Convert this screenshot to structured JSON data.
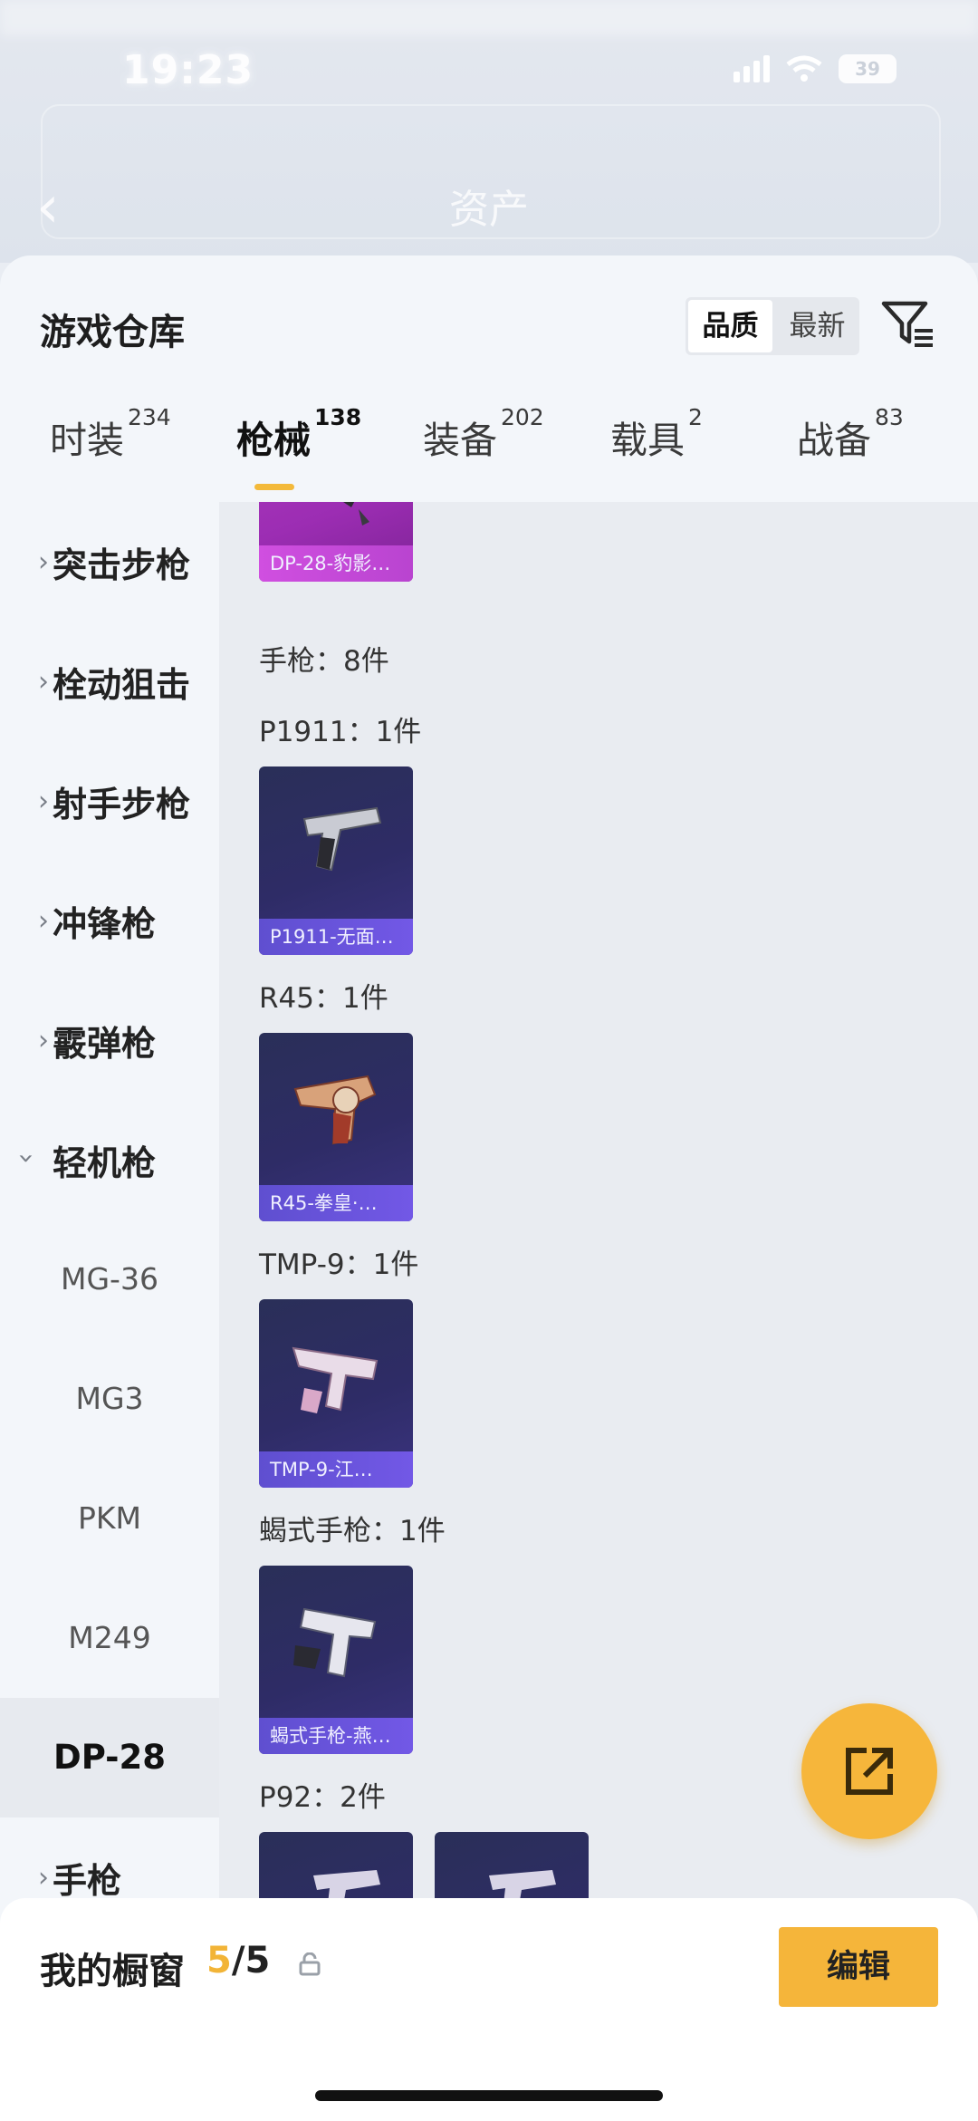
{
  "status": {
    "time": "19:23",
    "battery": "39"
  },
  "nav": {
    "back_icon": "chevron-left-icon",
    "title": "资产"
  },
  "sheet": {
    "title": "游戏仓库"
  },
  "sort": {
    "options": [
      "品质",
      "最新"
    ],
    "active": "品质"
  },
  "tabs": [
    {
      "label": "时装",
      "count": "234"
    },
    {
      "label": "枪械",
      "count": "138"
    },
    {
      "label": "装备",
      "count": "202"
    },
    {
      "label": "载具",
      "count": "2"
    },
    {
      "label": "战备",
      "count": "83"
    }
  ],
  "active_tab": "枪械",
  "sidebar": {
    "categories": [
      "突击步枪",
      "栓动狙击",
      "射手步枪",
      "冲锋枪",
      "霰弹枪",
      "轻机枪"
    ],
    "subitems": [
      "MG-36",
      "MG3",
      "PKM",
      "M249",
      "DP-28"
    ],
    "active_sub": "DP-28",
    "last_category": "手枪"
  },
  "content": {
    "top_card_caption": "DP-28-豹影…",
    "section_label": "手枪：8件",
    "groups": [
      {
        "label": "P1911：1件",
        "cards": [
          "P1911-无面…"
        ]
      },
      {
        "label": "R45：1件",
        "cards": [
          "R45-拳皇·…"
        ]
      },
      {
        "label": "TMP-9：1件",
        "cards": [
          "TMP-9-江…"
        ]
      },
      {
        "label": "蝎式手枪：1件",
        "cards": [
          "蝎式手枪-燕…"
        ]
      },
      {
        "label": "P92：2件",
        "cards": [
          "",
          ""
        ]
      }
    ]
  },
  "bottom": {
    "title": "我的橱窗",
    "current": "5",
    "total": "/5",
    "edit_label": "编辑"
  },
  "colors": {
    "accent": "#f5b53a",
    "card_bg": "#2e2c66",
    "card_caption": "#6a55dd",
    "legendary": "#b03cc0"
  }
}
